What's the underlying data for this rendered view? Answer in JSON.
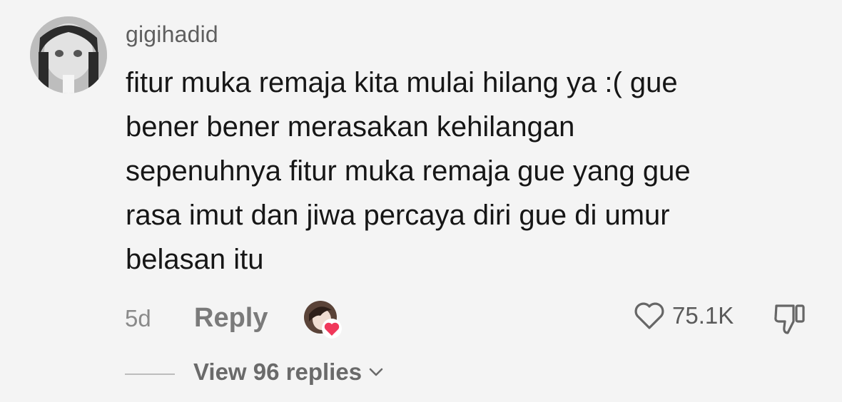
{
  "comment": {
    "username": "gigihadid",
    "text_lines": [
      "fitur muka remaja kita mulai hilang ya :( gue",
      "bener bener merasakan kehilangan",
      "sepenuhnya fitur muka remaja gue yang gue",
      "rasa imut dan jiwa percaya diri gue di umur",
      "belasan itu"
    ],
    "time_ago": "5d",
    "reply_label": "Reply",
    "like_count": "75.1K",
    "view_replies_label": "View 96 replies"
  },
  "icons": {
    "like": "heart-outline-icon",
    "dislike": "thumbs-down-icon",
    "chevron": "chevron-down-icon",
    "creator_liked": "heart-filled-icon"
  },
  "colors": {
    "background": "#f4f4f4",
    "text": "#161616",
    "muted": "#8a8a8a",
    "heart_badge": "#f0385a"
  }
}
